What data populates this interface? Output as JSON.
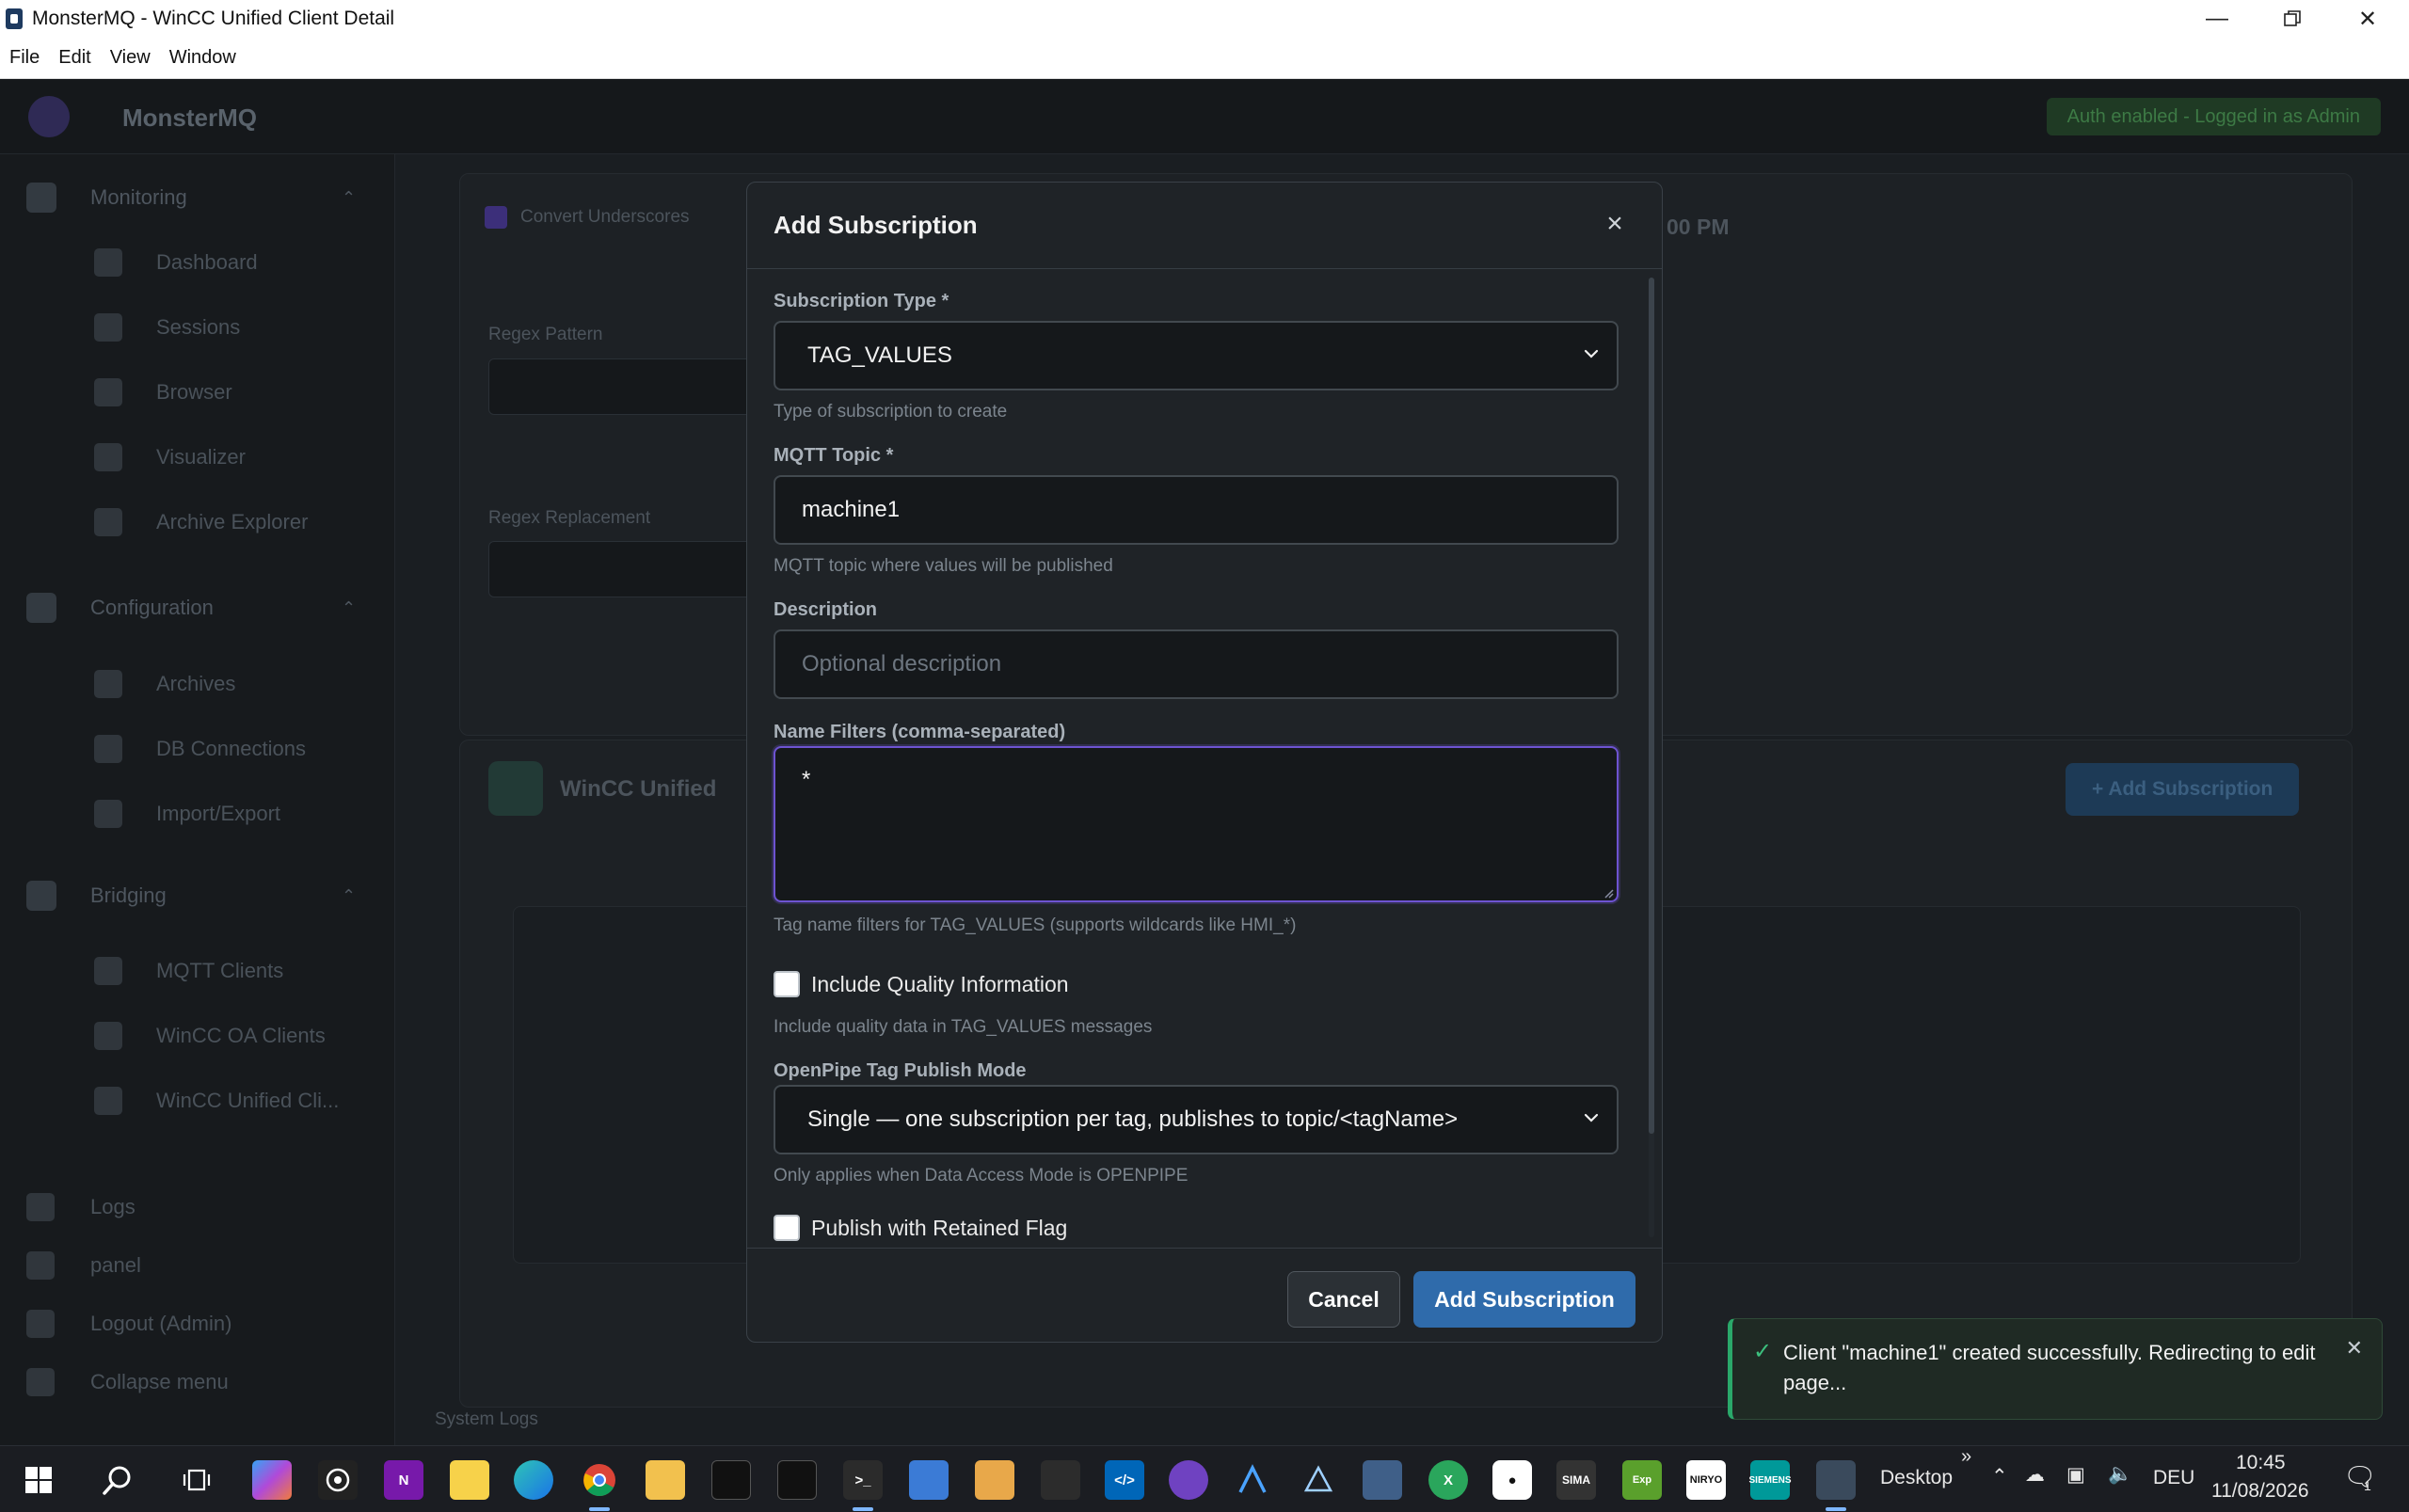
{
  "window": {
    "title": "MonsterMQ - WinCC Unified Client Detail",
    "menu": [
      "File",
      "Edit",
      "View",
      "Window"
    ]
  },
  "app": {
    "brand": "MonsterMQ",
    "auth_status": "Auth enabled - Logged in as Admin",
    "sidebar": {
      "sections": [
        {
          "label": "Monitoring",
          "items": [
            "Dashboard",
            "Sessions",
            "Browser",
            "Visualizer",
            "Archive Explorer"
          ]
        },
        {
          "label": "Configuration",
          "items": [
            "Archives",
            "DB Connections",
            "Import/Export"
          ]
        },
        {
          "label": "Bridging",
          "items": [
            "MQTT Clients",
            "WinCC OA Clients",
            "WinCC Unified Cli..."
          ]
        }
      ],
      "bottom": [
        "Logs",
        "panel",
        "Logout (Admin)",
        "Collapse menu"
      ]
    },
    "background": {
      "checkbox_label": "Convert Underscores",
      "regex_pattern_label": "Regex Pattern",
      "regex_replacement_label": "Regex Replacement",
      "client_card_title": "WinCC Unified",
      "add_subscription_label": "+ Add Subscription",
      "system_logs_label": "System Logs",
      "time_fragment": "00 PM"
    }
  },
  "modal": {
    "title": "Add Subscription",
    "subscription_type": {
      "label": "Subscription Type *",
      "value": "TAG_VALUES",
      "help": "Type of subscription to create"
    },
    "mqtt_topic": {
      "label": "MQTT Topic *",
      "value": "machine1",
      "help": "MQTT topic where values will be published"
    },
    "description": {
      "label": "Description",
      "value": "",
      "placeholder": "Optional description"
    },
    "name_filters": {
      "label": "Name Filters (comma-separated)",
      "value": "*",
      "help": "Tag name filters for TAG_VALUES (supports wildcards like HMI_*)"
    },
    "include_quality": {
      "label": "Include Quality Information",
      "checked": false,
      "help": "Include quality data in TAG_VALUES messages"
    },
    "publish_mode": {
      "label": "OpenPipe Tag Publish Mode",
      "value": "Single — one subscription per tag, publishes to topic/<tagName>",
      "help": "Only applies when Data Access Mode is OPENPIPE"
    },
    "retained_flag": {
      "label": "Publish with Retained Flag",
      "checked": false
    },
    "cancel_label": "Cancel",
    "submit_label": "Add Subscription"
  },
  "toast": {
    "message": "Client \"machine1\" created successfully. Redirecting to edit page...",
    "icon": "check-icon",
    "color": "#2aa86a"
  },
  "taskbar": {
    "desktop_label": "Desktop",
    "language": "DEU",
    "time": "10:45",
    "date": "11/08/2026",
    "notification_count": "1"
  },
  "colors": {
    "accent": "#2f6bab",
    "focus_border": "#6d53d1",
    "success": "#2aa86a"
  }
}
